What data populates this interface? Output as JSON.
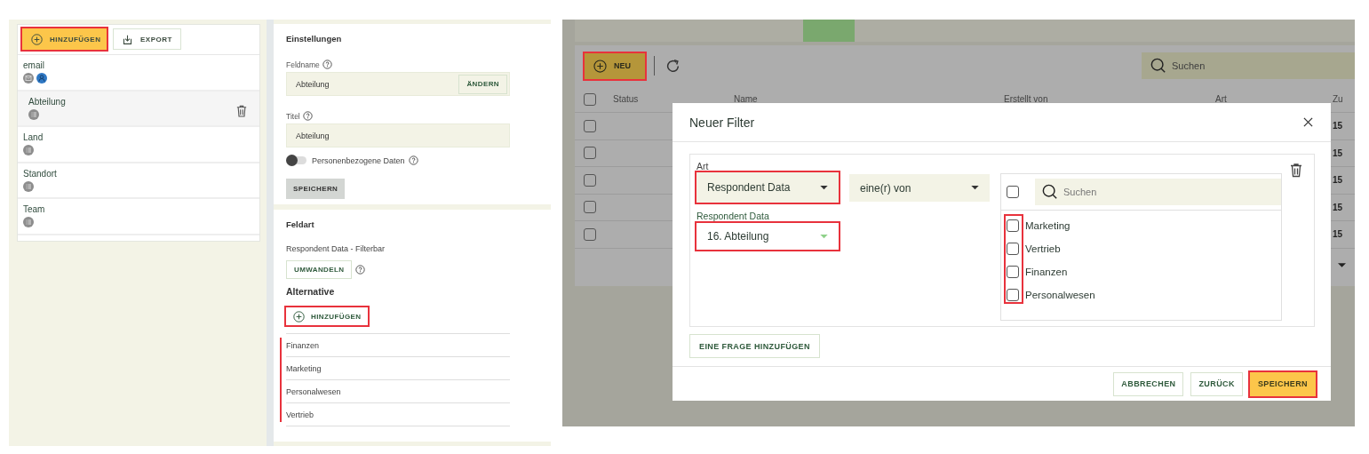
{
  "field_editor": {
    "toolbar": [
      {
        "label": "HINZUFÜGEN",
        "kind": "primary",
        "highlighted": true
      },
      {
        "label": "EXPORT",
        "kind": "export",
        "highlighted": false
      }
    ],
    "fields": [
      {
        "name": "email",
        "badges": [
          {
            "kind": "mail"
          },
          {
            "kind": "person"
          }
        ],
        "selected": false
      },
      {
        "name": "Abteilung",
        "badges": [
          {
            "kind": "list"
          }
        ],
        "selected": true
      },
      {
        "name": "Land",
        "badges": [
          {
            "kind": "list"
          }
        ],
        "selected": false
      },
      {
        "name": "Standort",
        "badges": [
          {
            "kind": "list"
          }
        ],
        "selected": false
      },
      {
        "name": "Team",
        "badges": [
          {
            "kind": "list"
          }
        ],
        "selected": false
      }
    ],
    "settings": {
      "title": "Einstellungen",
      "field_name": {
        "label": "Feldname",
        "value": "Abteilung",
        "button": "ÄNDERN"
      },
      "title_field": {
        "label": "Titel",
        "value": "Abteilung"
      },
      "personal_data": {
        "label": "Personenbezogene Daten",
        "on": false
      },
      "save_button": "SPEICHERN"
    },
    "field_type": {
      "title": "Feldart",
      "type_text": "Respondent Data - Filterbar",
      "convert_button": "UMWANDELN",
      "alternatives_title": "Alternative",
      "add_button": {
        "label": "HINZUFÜGEN",
        "highlighted": true
      },
      "alternatives_highlighted": true,
      "alternatives": [
        "Finanzen",
        "Marketing",
        "Personalwesen",
        "Vertrieb"
      ]
    }
  },
  "filter_page": {
    "toolbar": {
      "new_button": {
        "label": "NEU",
        "highlighted": true
      },
      "search": {
        "placeholder": "Suchen"
      }
    },
    "table": {
      "all_checked": false,
      "columns": [
        "Status",
        "Name",
        "Erstellt von",
        "Art",
        "Zu"
      ],
      "rows": [
        {
          "checked": false,
          "column_5": "15"
        },
        {
          "checked": false,
          "column_5": "15"
        },
        {
          "checked": false,
          "column_5": "15"
        },
        {
          "checked": false,
          "column_5": "15"
        },
        {
          "checked": false,
          "column_5": "15"
        }
      ]
    },
    "dialog": {
      "title": "Neuer Filter",
      "type": {
        "label": "Art",
        "value": "Respondent Data",
        "highlighted": true
      },
      "operator": {
        "value": "eine(r) von"
      },
      "question": {
        "label": "Respondent Data",
        "value": "16. Abteilung",
        "highlighted": true
      },
      "search": {
        "placeholder": "Suchen"
      },
      "select_all_checked": false,
      "options_highlighted": true,
      "options": [
        {
          "label": "Marketing",
          "checked": false
        },
        {
          "label": "Vertrieb",
          "checked": false
        },
        {
          "label": "Finanzen",
          "checked": false
        },
        {
          "label": "Personalwesen",
          "checked": false
        }
      ],
      "add_question_button": "EINE FRAGE HINZUFÜGEN",
      "buttons": [
        {
          "label": "ABBRECHEN",
          "kind": "secondary",
          "highlighted": false
        },
        {
          "label": "ZURÜCK",
          "kind": "secondary",
          "highlighted": false
        },
        {
          "label": "SPEICHERN",
          "kind": "primary",
          "highlighted": true
        }
      ]
    }
  }
}
